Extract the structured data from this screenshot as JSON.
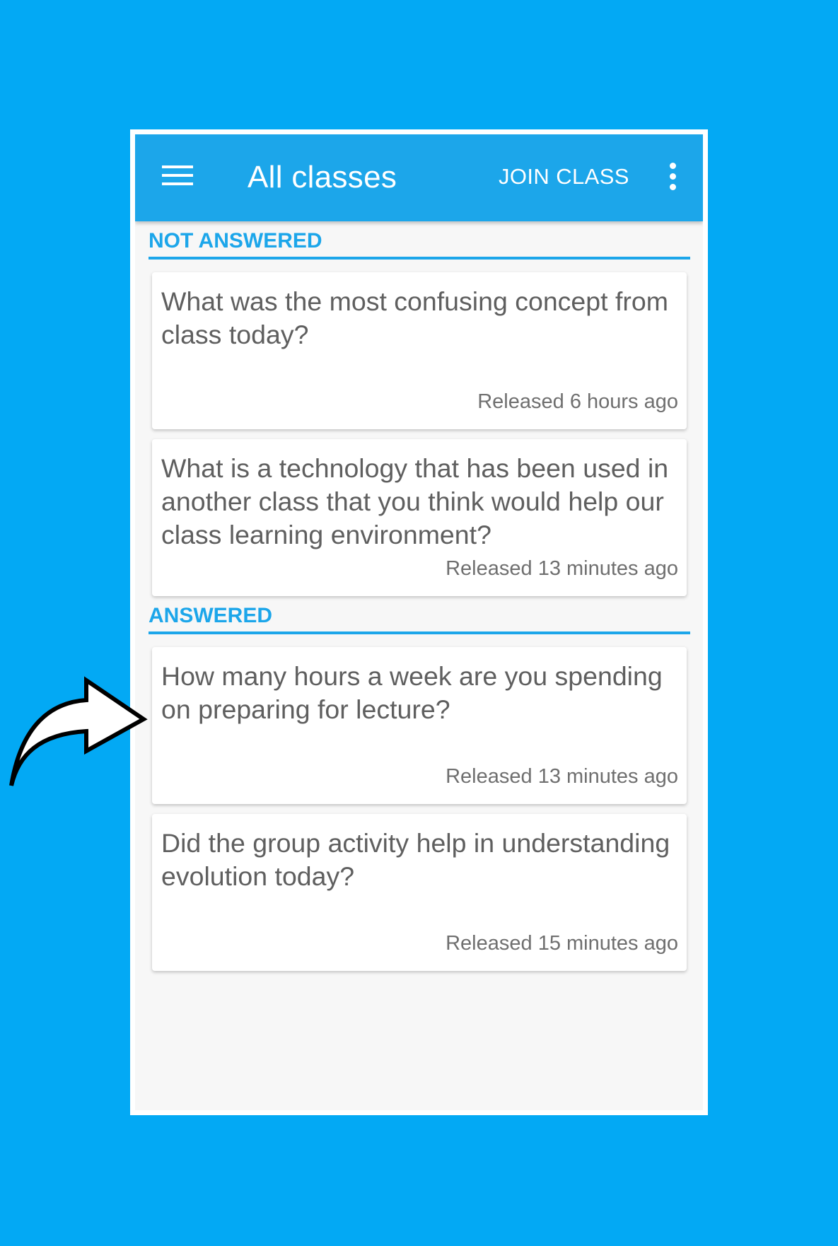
{
  "appbar": {
    "title": "All classes",
    "join_label": "JOIN CLASS",
    "menu_icon": "hamburger-menu-icon",
    "overflow_icon": "more-vertical-icon"
  },
  "sections": [
    {
      "title": "NOT ANSWERED",
      "cards": [
        {
          "question": "What was the most confusing concept from class today?",
          "released": "Released 6 hours ago"
        },
        {
          "question": "What is a technology that has been used in another class that you think would help our class learning environment?",
          "released": "Released 13 minutes ago"
        }
      ]
    },
    {
      "title": "ANSWERED",
      "cards": [
        {
          "question": "How many hours a week are you spending on preparing for lecture?",
          "released": "Released 13 minutes ago"
        },
        {
          "question": "Did the group activity help in understanding evolution today?",
          "released": "Released 15 minutes ago"
        }
      ]
    }
  ],
  "colors": {
    "background": "#03a9f4",
    "appbar": "#1ca6ea",
    "accent": "#1ca6ea",
    "question_text": "#5f5f5f"
  },
  "annotation": {
    "icon": "curved-arrow-icon"
  }
}
